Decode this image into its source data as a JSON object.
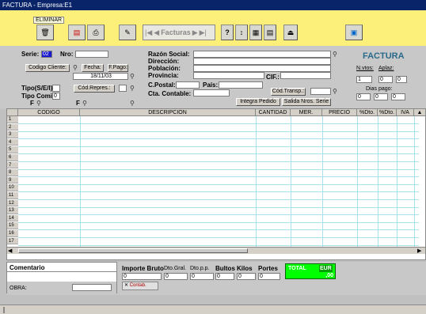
{
  "title": "FACTURA - Empresa:E1",
  "toolbar": {
    "eliminar_label": "ELIMINAR",
    "nav_label": "Facturas",
    "help_label": "?"
  },
  "header": {
    "serie_label": "Serie:",
    "serie_value": "02",
    "nro_label": "Nro:",
    "nro_value": "",
    "codigo_cliente_label": "Codigo Cliente:",
    "fecha_label": "Fecha:",
    "fecha_value": "18/11/03",
    "fpago_label": "F.Pago:",
    "tipo_label": "Tipo(S/E/I):",
    "cod_repres_label": "Cód.Repres.:",
    "tipo_comis_label": "Tipo Comis.:",
    "tipo_comis_value": "0",
    "f_label": "F",
    "razon_social_label": "Razón Social:",
    "direccion_label": "Dirección:",
    "poblacion_label": "Población:",
    "provincia_label": "Provincia:",
    "cif_label": "CIF.:",
    "cpostal_label": "C.Postal:",
    "pais_label": "País:",
    "cta_contable_label": "Cta. Contable:",
    "cod_transp_label": "Cód.Transp.:",
    "integra_pedido_label": "Integra Pedido",
    "salida_nros_serie_label": "Salida Nros. Serie",
    "factura_title": "FACTURA",
    "nvtos_label": "N.vtos:",
    "aplaz_label": "Aplaz:",
    "nvtos_value": "1",
    "aplaz_value": "0",
    "aplaz2_value": "0",
    "dias_pago_label": "Dias pago:",
    "dias1": "0",
    "dias2": "0",
    "dias3": "0"
  },
  "grid": {
    "columns": [
      "CODIGO",
      "DESCRIPCION",
      "CANTIDAD",
      "MER.",
      "PRECIO",
      "%Dto.",
      "%Dto.",
      "IVA"
    ],
    "rows": [
      "1",
      "2",
      "3",
      "4",
      "5",
      "6",
      "7",
      "8",
      "9",
      "10",
      "11",
      "12",
      "13",
      "14",
      "15",
      "16",
      "17"
    ]
  },
  "footer": {
    "comentario_label": "Comentario",
    "obra_label": "OBRA:",
    "importe_bruto_label": "Importe Bruto",
    "dto_gral_label": "Dto.Gral.",
    "dto_pp_label": "Dto.p.p.",
    "bultos_label": "Bultos",
    "kilos_label": "Kilos",
    "portes_label": "Portes",
    "total_label": "TOTAL",
    "eur_label": "EUR",
    "total_value": ",00",
    "importe_value": "0",
    "dto_gral_value": "0",
    "dto_pp_value": "0",
    "bultos_value": "0",
    "kilos_value": "0",
    "portes_value": "0",
    "contab_label": "Contab."
  },
  "colors": {
    "titlebar": "#0a246a",
    "toolbar": "#fcf07a",
    "total_bg": "#00ff00",
    "factura_title": "#2a6a8a"
  }
}
